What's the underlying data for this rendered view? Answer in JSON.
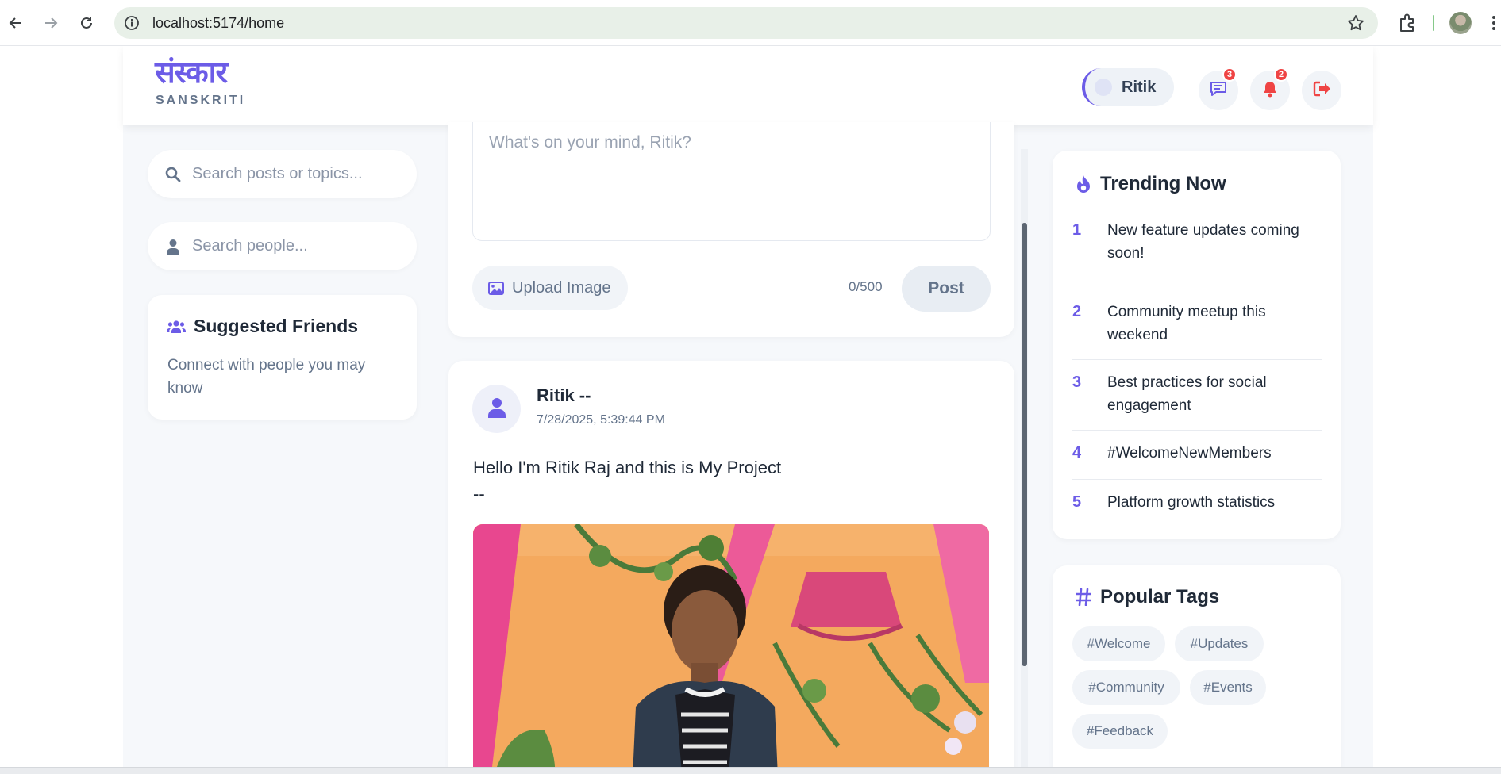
{
  "browser": {
    "url": "localhost:5174/home"
  },
  "header": {
    "logo_main": "संस्कार",
    "logo_sub": "SANSKRITI",
    "user_name": "Ritik",
    "messages_badge": "3",
    "notifications_badge": "2"
  },
  "left_sidebar": {
    "search_posts_placeholder": "Search posts or topics...",
    "search_people_placeholder": "Search people...",
    "suggested_title": "Suggested Friends",
    "suggested_text": "Connect with people you may know"
  },
  "composer": {
    "placeholder": "What's on your mind, Ritik?",
    "upload_label": "Upload Image",
    "char_count": "0/500",
    "post_label": "Post"
  },
  "post": {
    "author": "Ritik --",
    "timestamp": "7/28/2025, 5:39:44 PM",
    "text": "Hello I'm Ritik Raj and this is My Project\n--"
  },
  "trending": {
    "title": "Trending Now",
    "items": [
      {
        "num": "1",
        "text": "New feature updates coming soon!"
      },
      {
        "num": "2",
        "text": "Community meetup this weekend"
      },
      {
        "num": "3",
        "text": "Best practices for social engagement"
      },
      {
        "num": "4",
        "text": "#WelcomeNewMembers"
      },
      {
        "num": "5",
        "text": "Platform growth statistics"
      }
    ]
  },
  "tags": {
    "title": "Popular Tags",
    "items": [
      "#Welcome",
      "#Updates",
      "#Community",
      "#Events",
      "#Feedback"
    ]
  },
  "colors": {
    "accent": "#6c5ce7",
    "badge": "#ef4444",
    "logout": "#ef4444"
  }
}
